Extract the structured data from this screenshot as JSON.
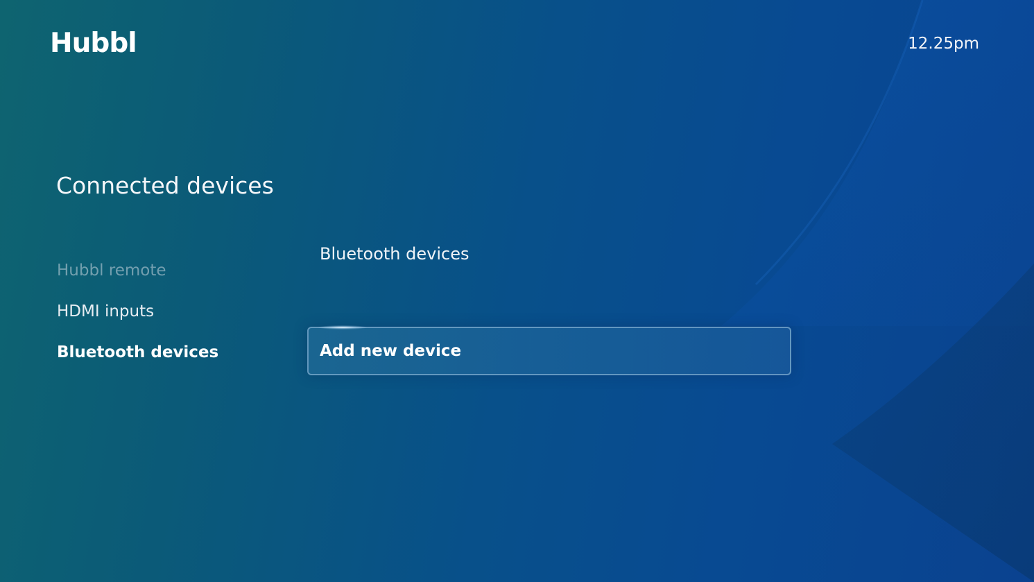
{
  "app": {
    "logo_text": "Hubbl",
    "clock": "12.25pm"
  },
  "page": {
    "title": "Connected devices"
  },
  "menu": {
    "items": [
      {
        "label": "Hubbl remote",
        "state": "disabled"
      },
      {
        "label": "HDMI inputs",
        "state": "normal"
      },
      {
        "label": "Bluetooth devices",
        "state": "selected"
      }
    ]
  },
  "bluetooth": {
    "section_title": "Bluetooth devices",
    "add_button_label": "Add new device"
  },
  "colors": {
    "background_teal": "#0e6470",
    "background_blue": "#084a92",
    "accent_curve": "#0d52a8",
    "text": "#ffffff"
  }
}
